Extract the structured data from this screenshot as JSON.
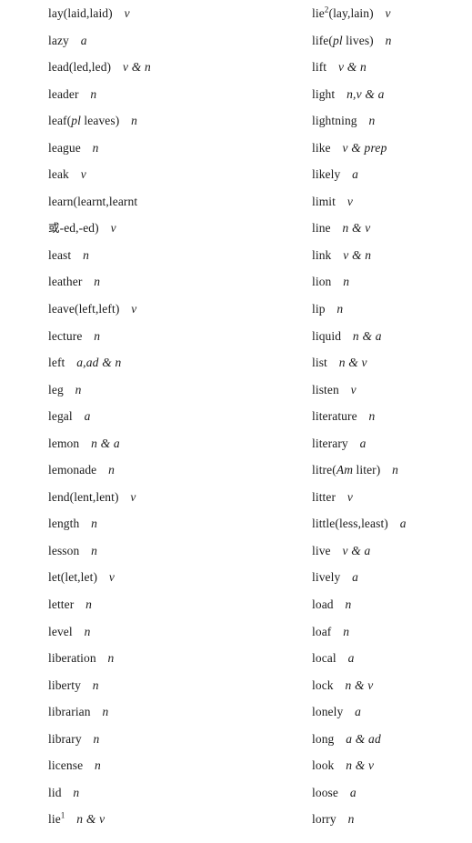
{
  "page": {
    "type": "dictionary-word-list",
    "background_color": "#ffffff",
    "text_color": "#1a1a1a",
    "columns": 2
  },
  "columns": [
    {
      "name": "left-column",
      "entries": [
        {
          "headword": "lay(laid,laid)",
          "pos": "v"
        },
        {
          "headword": "lazy",
          "pos": "a"
        },
        {
          "headword": "lead(led,led)",
          "pos": "v & n"
        },
        {
          "headword": "leader",
          "pos": "n"
        },
        {
          "headword": "leaf(",
          "italic": "pl",
          "headword_tail": " leaves)",
          "pos": "n"
        },
        {
          "headword": "league",
          "pos": "n"
        },
        {
          "headword": "leak",
          "pos": "v"
        },
        {
          "headword": "learn(learnt,learnt",
          "pos": ""
        },
        {
          "cjk": "或",
          "headword": "-ed,-ed)",
          "pos": "v"
        },
        {
          "headword": "least",
          "pos": "n"
        },
        {
          "headword": "leather",
          "pos": "n"
        },
        {
          "headword": "leave(left,left)",
          "pos": "v"
        },
        {
          "headword": "lecture",
          "pos": "n"
        },
        {
          "headword": "left",
          "pos": "a,ad & n"
        },
        {
          "headword": "leg",
          "pos": "n"
        },
        {
          "headword": "legal",
          "pos": "a"
        },
        {
          "headword": "lemon",
          "pos": "n & a"
        },
        {
          "headword": "lemonade",
          "pos": "n"
        },
        {
          "headword": "lend(lent,lent)",
          "pos": "v"
        },
        {
          "headword": "length",
          "pos": "n"
        },
        {
          "headword": "lesson",
          "pos": "n"
        },
        {
          "headword": "let(let,let)",
          "pos": "v"
        },
        {
          "headword": "letter",
          "pos": "n"
        },
        {
          "headword": "level",
          "pos": "n"
        },
        {
          "headword": "liberation",
          "pos": "n"
        },
        {
          "headword": "liberty",
          "pos": "n"
        },
        {
          "headword": "librarian",
          "pos": "n"
        },
        {
          "headword": "library",
          "pos": "n"
        },
        {
          "headword": "license",
          "pos": "n"
        },
        {
          "headword": "lid",
          "pos": "n"
        },
        {
          "headword": "lie",
          "sup": "1",
          "pos": "n & v"
        }
      ]
    },
    {
      "name": "right-column",
      "entries": [
        {
          "headword": "lie",
          "sup": "2",
          "headword_tail": "(lay,lain)",
          "pos": "v"
        },
        {
          "headword": "life(",
          "italic": "pl",
          "headword_tail": " lives)",
          "pos": "n"
        },
        {
          "headword": "lift",
          "pos": "v & n"
        },
        {
          "headword": "light",
          "pos": "n,v & a"
        },
        {
          "headword": "lightning",
          "pos": "n"
        },
        {
          "headword": "like",
          "pos": "v & prep"
        },
        {
          "headword": "likely",
          "pos": "a"
        },
        {
          "headword": "limit",
          "pos": "v"
        },
        {
          "headword": "line",
          "pos": "n & v"
        },
        {
          "headword": "link",
          "pos": "v & n"
        },
        {
          "headword": "lion",
          "pos": "n"
        },
        {
          "headword": "lip",
          "pos": "n"
        },
        {
          "headword": "liquid",
          "pos": "n & a"
        },
        {
          "headword": "list",
          "pos": "n & v"
        },
        {
          "headword": "listen",
          "pos": "v"
        },
        {
          "headword": "literature",
          "pos": "n"
        },
        {
          "headword": "literary",
          "pos": "a"
        },
        {
          "headword": "litre(",
          "italic": "Am",
          "headword_tail": " liter)",
          "pos": "n"
        },
        {
          "headword": "litter",
          "pos": "v"
        },
        {
          "headword": "little(less,least)",
          "pos": "a"
        },
        {
          "headword": "live",
          "pos": "v & a"
        },
        {
          "headword": "lively",
          "pos": "a"
        },
        {
          "headword": "load",
          "pos": "n"
        },
        {
          "headword": "loaf",
          "pos": "n"
        },
        {
          "headword": "local",
          "pos": "a"
        },
        {
          "headword": "lock",
          "pos": "n & v"
        },
        {
          "headword": "lonely",
          "pos": "a"
        },
        {
          "headword": "long",
          "pos": "a & ad"
        },
        {
          "headword": "look",
          "pos": "n & v"
        },
        {
          "headword": "loose",
          "pos": "a"
        },
        {
          "headword": "lorry",
          "pos": "n"
        }
      ]
    }
  ]
}
